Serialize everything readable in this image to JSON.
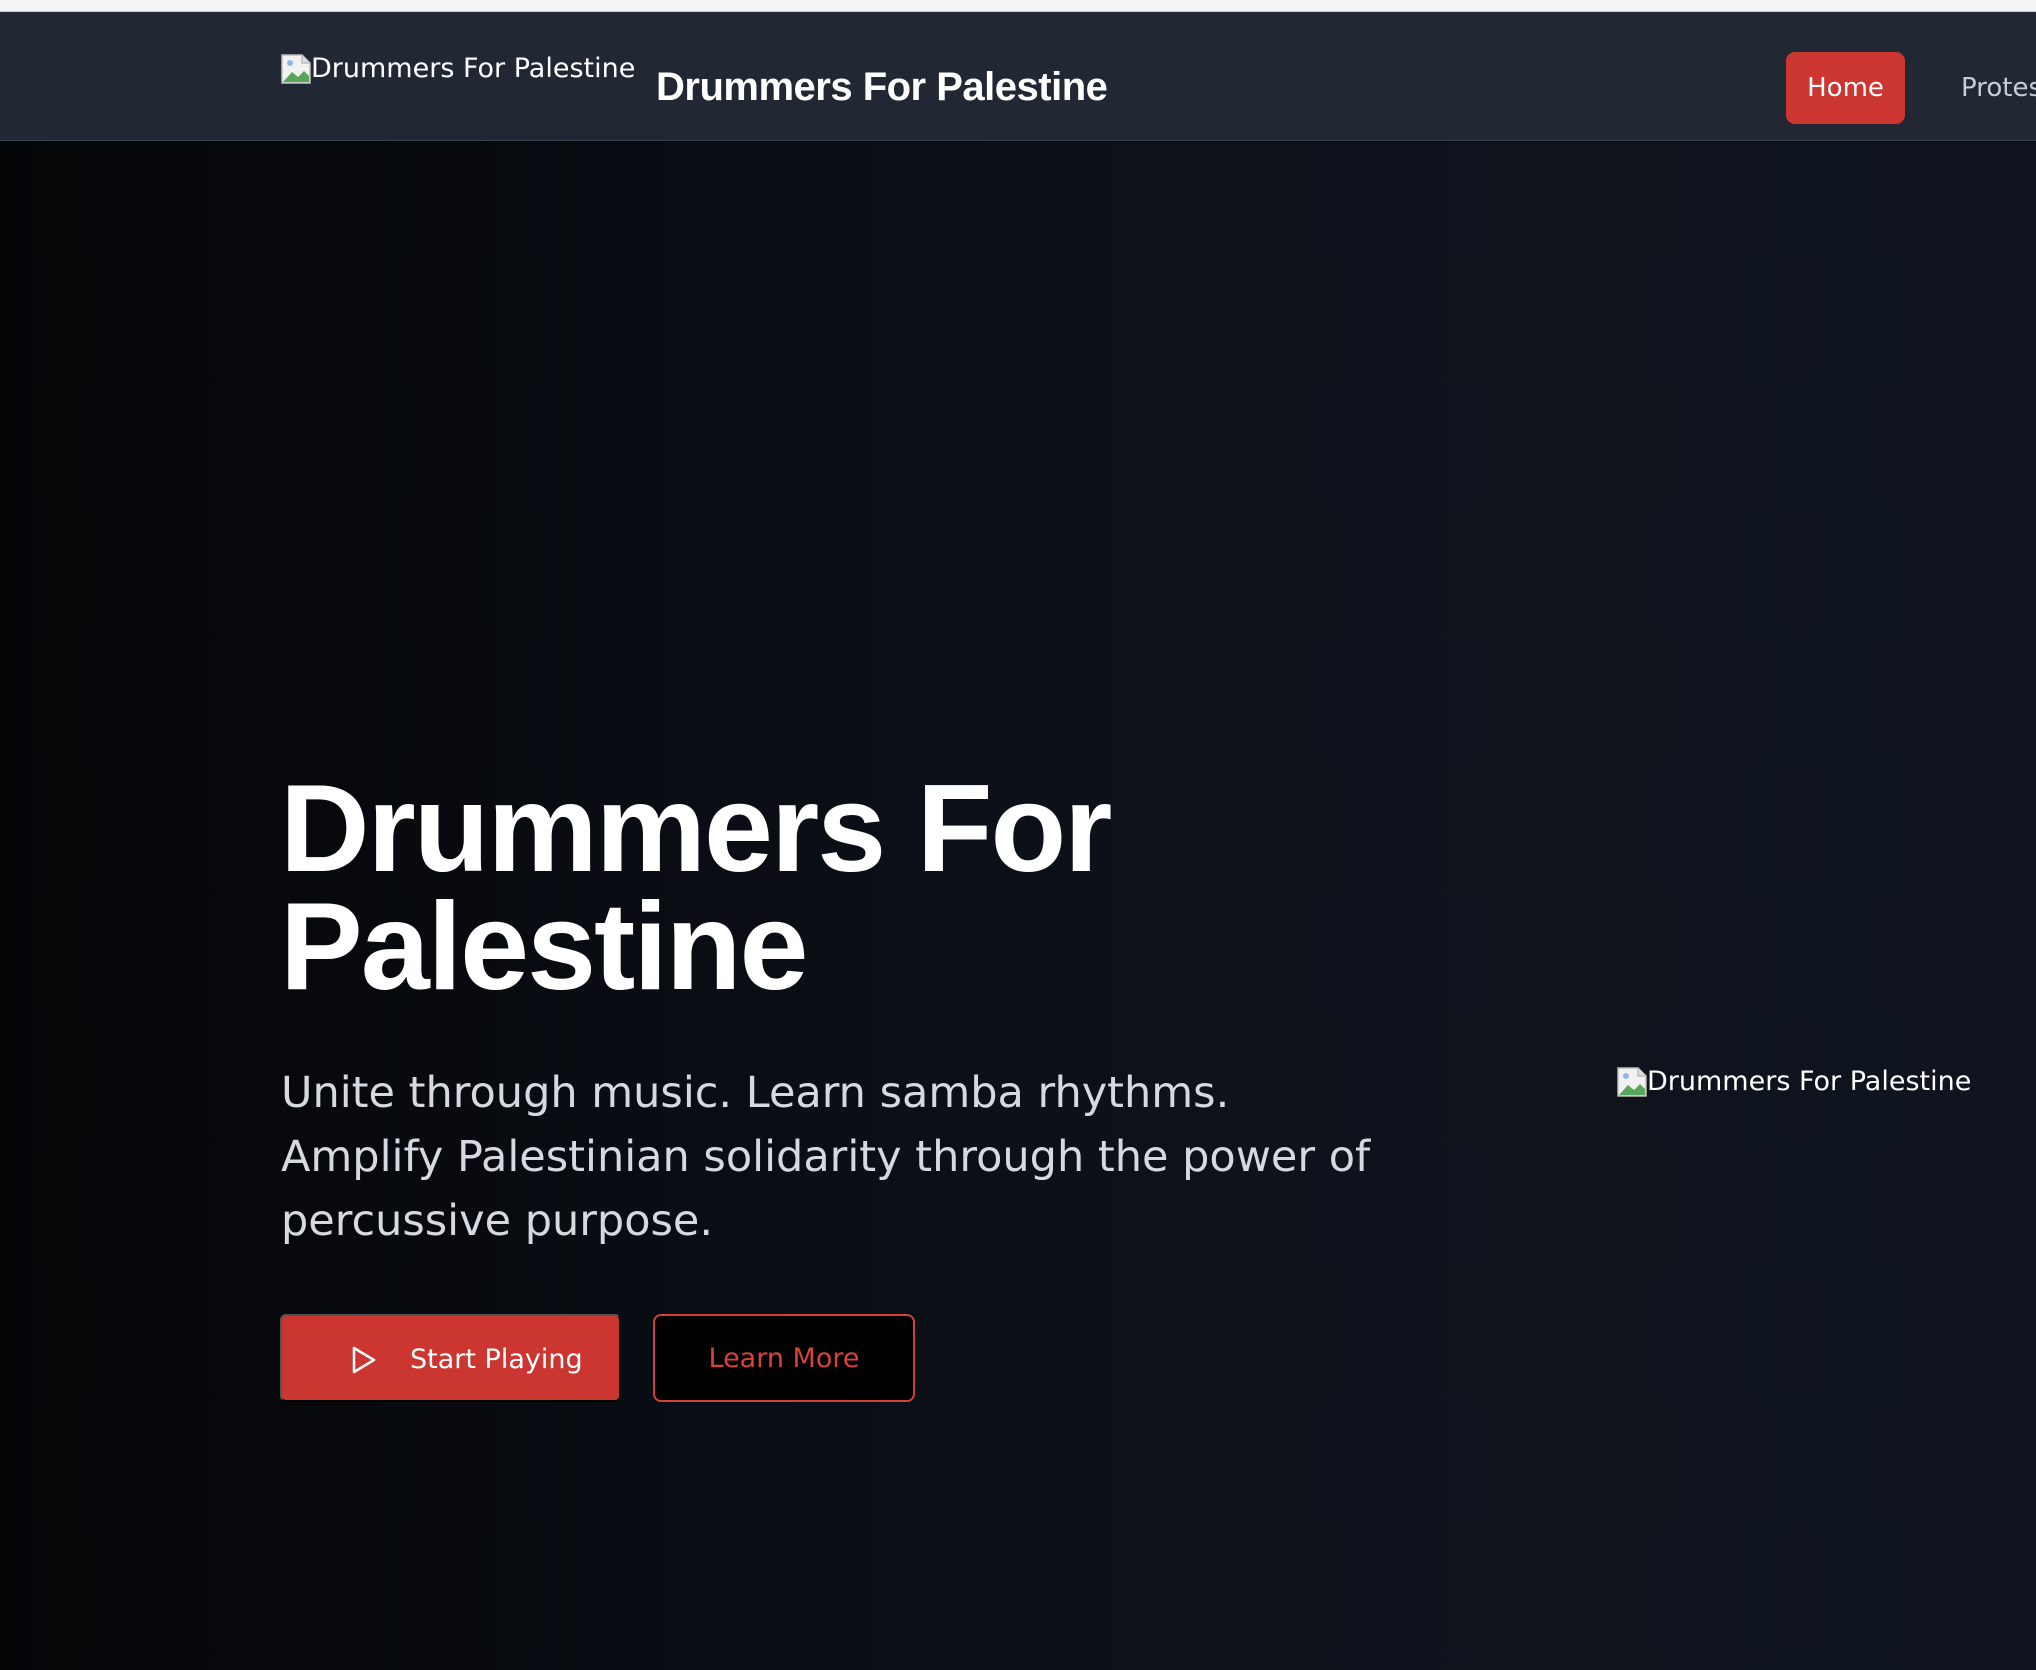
{
  "navbar": {
    "logo_alt": "Drummers For Palestine",
    "brand": "Drummers For Palestine",
    "links": [
      {
        "label": "Home",
        "active": true
      },
      {
        "label": "Protes"
      }
    ]
  },
  "hero": {
    "title": "Drummers For Palestine",
    "subtitle": "Unite through music. Learn samba rhythms. Amplify Palestinian solidarity through the power of percussive purpose.",
    "primary_button": {
      "label": "Start Playing",
      "icon": "play-icon"
    },
    "secondary_button": {
      "label": "Learn More"
    },
    "image_alt": "Drummers For Palestine"
  },
  "colors": {
    "accent": "#cc3630",
    "navbar_bg": "#212833",
    "hero_bg": "#0b0f16",
    "text": "#ffffff",
    "muted_text": "#d5d9e0"
  }
}
